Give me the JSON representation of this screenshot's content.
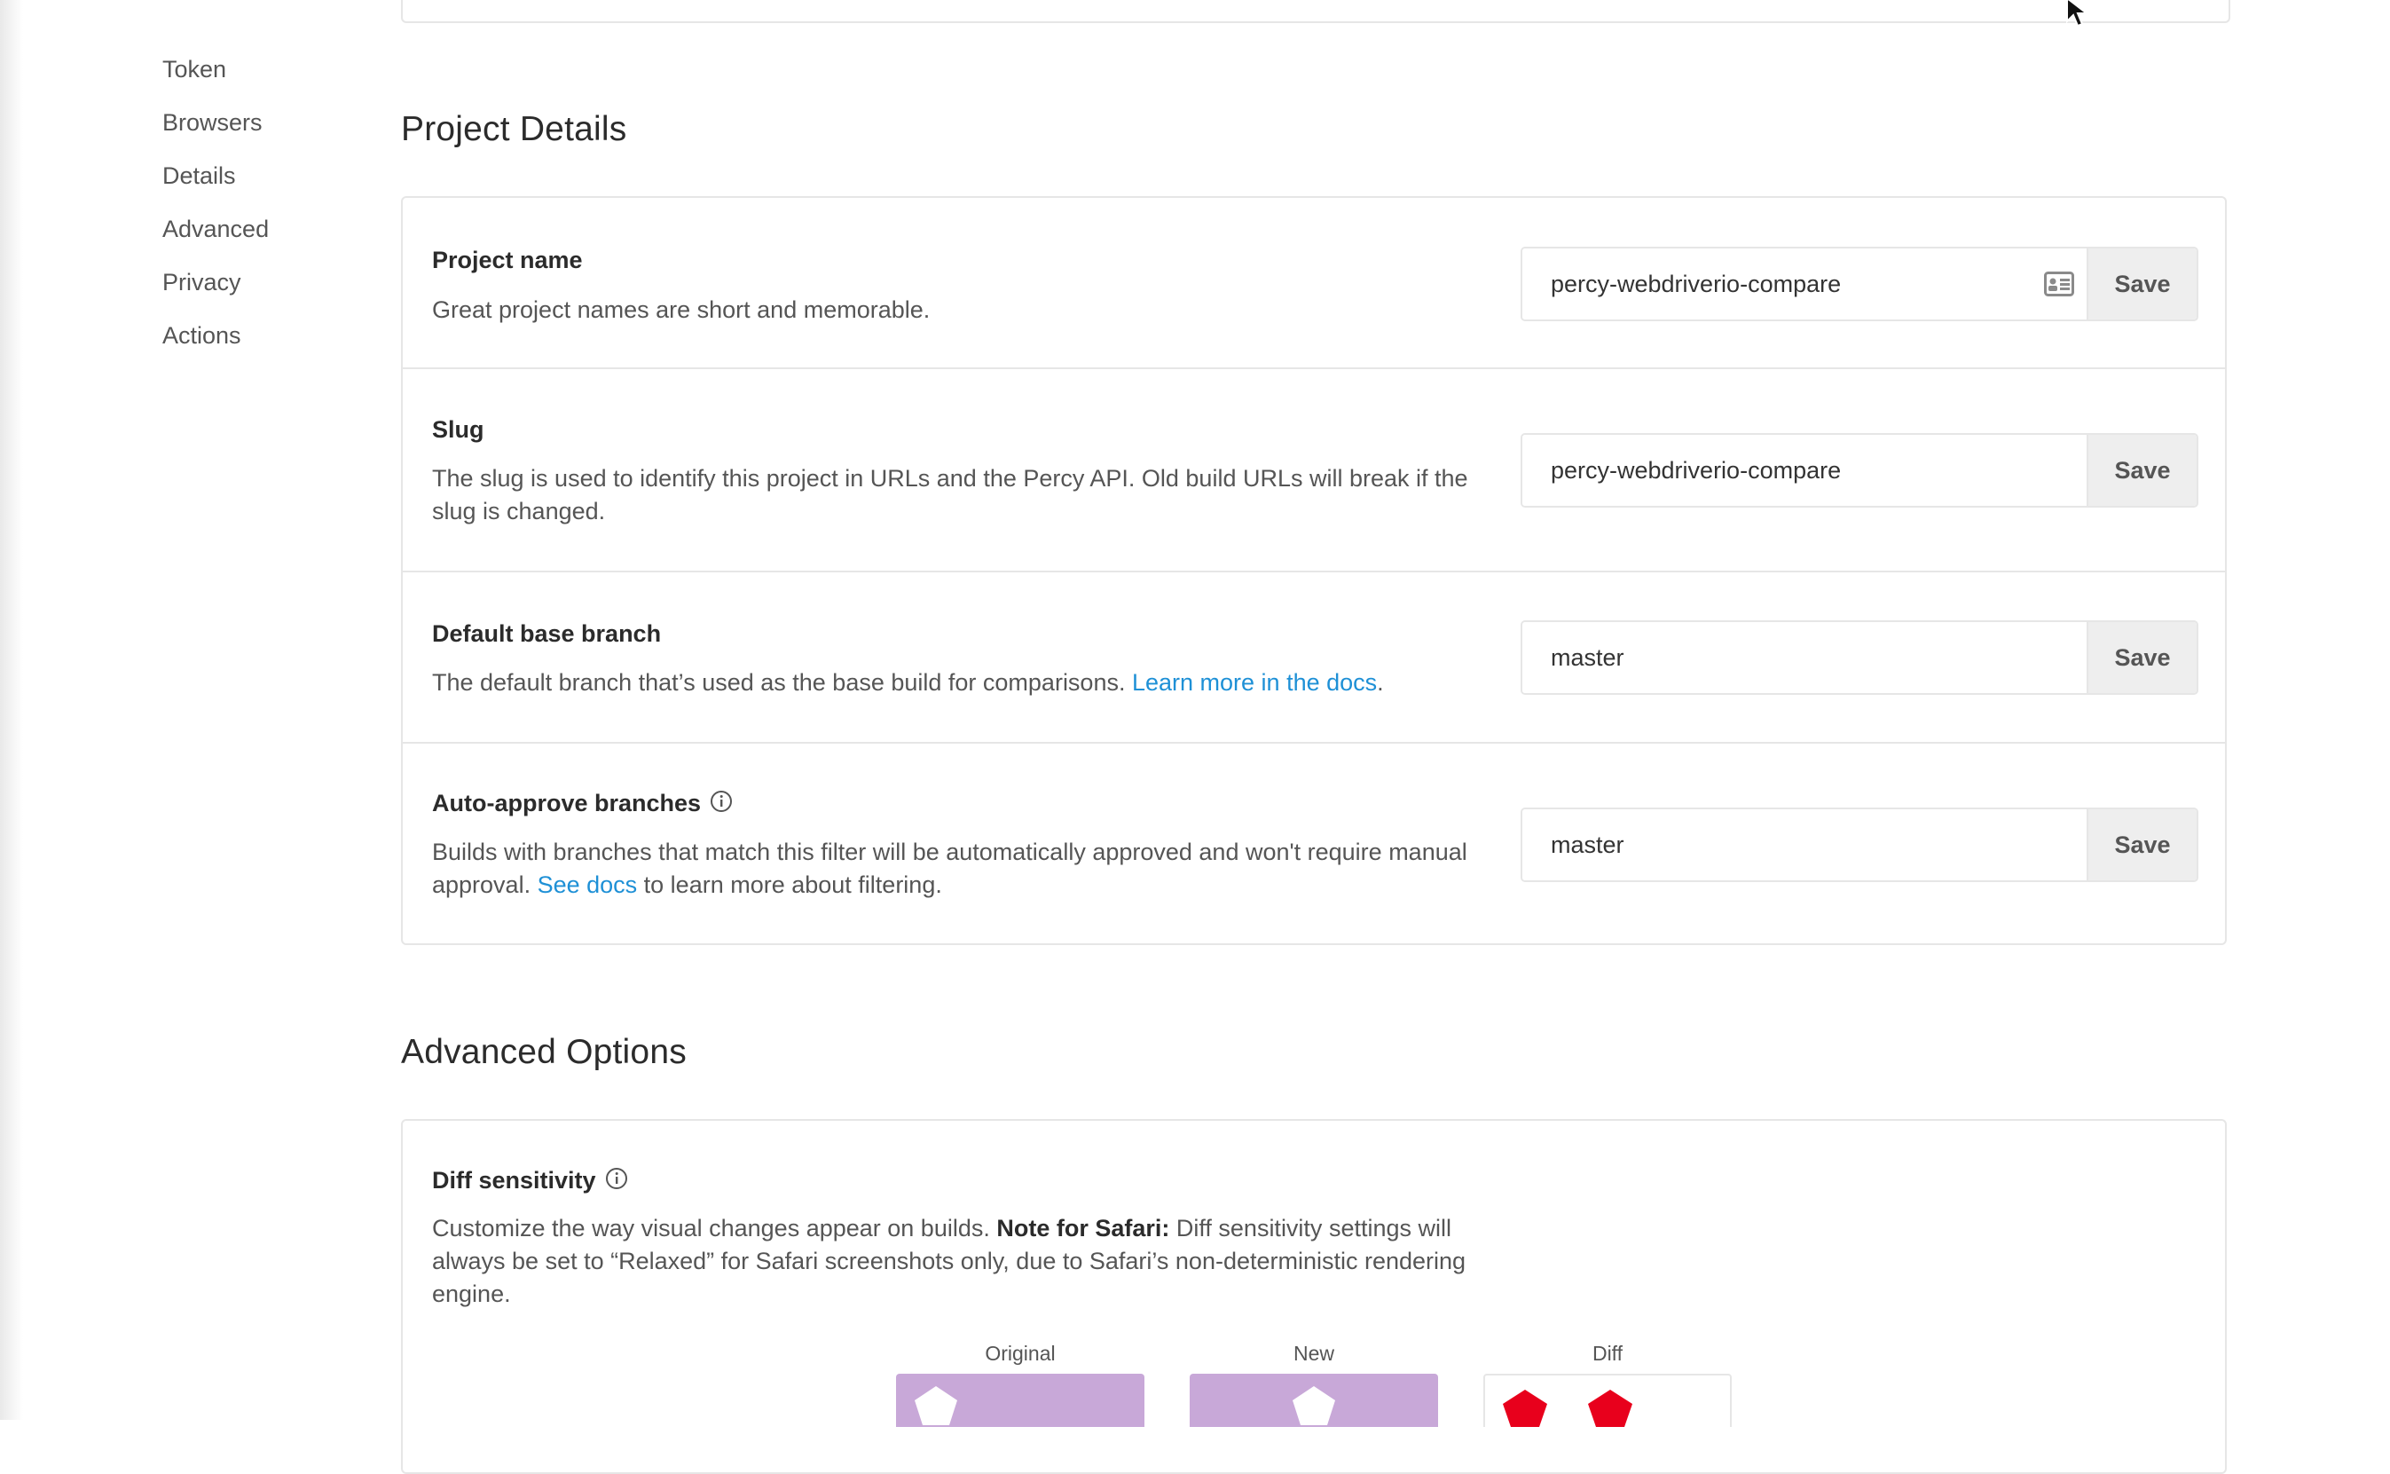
{
  "sidebar": {
    "items": [
      {
        "label": "Token"
      },
      {
        "label": "Browsers"
      },
      {
        "label": "Details"
      },
      {
        "label": "Advanced"
      },
      {
        "label": "Privacy"
      },
      {
        "label": "Actions"
      }
    ]
  },
  "project_details": {
    "heading": "Project Details",
    "rows": [
      {
        "title": "Project name",
        "description": "Great project names are short and memorable.",
        "value": "percy-webdriverio-compare",
        "save_label": "Save"
      },
      {
        "title": "Slug",
        "description": "The slug is used to identify this project in URLs and the Percy API. Old build URLs will break if the slug is changed.",
        "value": "percy-webdriverio-compare",
        "save_label": "Save"
      },
      {
        "title": "Default base branch",
        "description": "The default branch that’s used as the base build for comparisons. ",
        "link": "Learn more in the docs",
        "after_link": ".",
        "value": "master",
        "save_label": "Save"
      },
      {
        "title": "Auto-approve branches",
        "description": "Builds with branches that match this filter will be automatically approved and won't require manual approval. ",
        "link": "See docs",
        "after_link": " to learn more about filtering.",
        "value": "master",
        "save_label": "Save"
      }
    ]
  },
  "advanced_options": {
    "heading": "Advanced Options",
    "diff_sensitivity": {
      "title": "Diff sensitivity",
      "description_start": "Customize the way visual changes appear on builds. ",
      "note_label": "Note for Safari:",
      "description_end": " Diff sensitivity settings will always be set to “Relaxed” for Safari screenshots only, due to Safari’s non-deterministic rendering engine.",
      "labels": {
        "original": "Original",
        "new": "New",
        "diff": "Diff"
      }
    }
  },
  "colors": {
    "link": "#1e90d6",
    "preview_fill": "#c8a8d8",
    "diff_highlight": "#e8001c",
    "button_bg": "#eeeeee"
  },
  "icons": [
    "contact-card-icon",
    "info-icon",
    "mouse-cursor-icon",
    "pentagon-shape"
  ]
}
